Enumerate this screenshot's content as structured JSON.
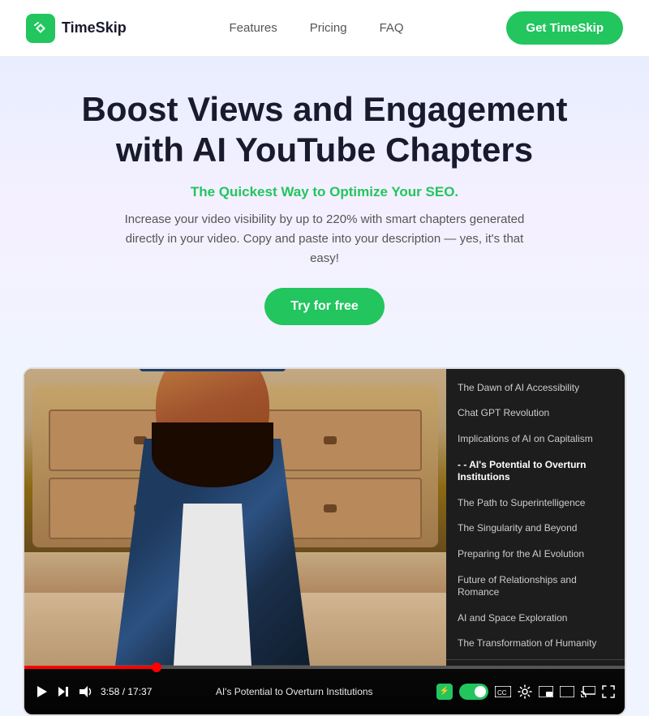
{
  "navbar": {
    "logo_text": "TimeSkip",
    "nav_links": [
      {
        "label": "Features",
        "id": "features"
      },
      {
        "label": "Pricing",
        "id": "pricing"
      },
      {
        "label": "FAQ",
        "id": "faq"
      }
    ],
    "cta_label": "Get TimeSkip"
  },
  "hero": {
    "headline_line1": "Boost Views and Engagement",
    "headline_line2": "with AI YouTube Chapters",
    "subtitle": "The Quickest Way to Optimize Your SEO.",
    "description": "Increase your video visibility by up to 220% with smart chapters generated directly in your video. Copy and paste into your description — yes, it's that easy!",
    "try_button": "Try for free"
  },
  "video": {
    "chapters": [
      {
        "label": "The Dawn of AI Accessibility",
        "active": false
      },
      {
        "label": "Chat GPT Revolution",
        "active": false
      },
      {
        "label": "Implications of AI on Capitalism",
        "active": false
      },
      {
        "label": "AI's Potential to Overturn Institutions",
        "active": true
      },
      {
        "label": "The Path to Superintelligence",
        "active": false
      },
      {
        "label": "The Singularity and Beyond",
        "active": false
      },
      {
        "label": "Preparing for the AI Evolution",
        "active": false
      },
      {
        "label": "Future of Relationships and Romance",
        "active": false
      },
      {
        "label": "AI and Space Exploration",
        "active": false
      },
      {
        "label": "The Transformation of Humanity",
        "active": false
      }
    ],
    "time_current": "3:58",
    "time_total": "17:37",
    "chapter_label": "AI's Potential to Overturn Institutions",
    "progress_percent": 22
  }
}
